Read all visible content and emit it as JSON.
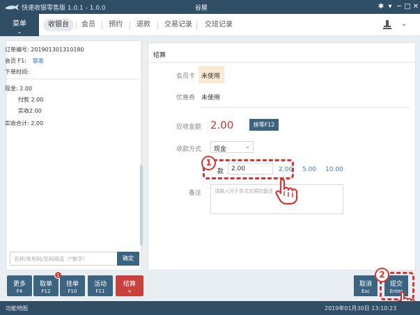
{
  "window": {
    "app_title": "快速收银零售版 1.0.1 - 1.0.0",
    "center_title": "谷屋",
    "controls": [
      "gear-icon",
      "chevron-down-icon",
      "minimize-icon",
      "maximize-icon",
      "close-icon"
    ],
    "controls_glyphs": [
      "✱",
      "▾",
      "─",
      "□",
      "✕"
    ]
  },
  "nav": {
    "menu_label": "菜单",
    "tabs": [
      {
        "label": "收银台",
        "active": true
      },
      {
        "label": "会员"
      },
      {
        "label": "预约"
      },
      {
        "label": "退款"
      },
      {
        "label": "交易记录"
      },
      {
        "label": "交班记录"
      }
    ]
  },
  "order": {
    "number_label": "订单编号: 201901301310180",
    "member_prefix": "会员 F1:",
    "member_link": "散客",
    "time_label": "下单时间:",
    "cash_label": "现金: 2.00",
    "paid_label": "付款 2.00",
    "received_label": "实收2.00",
    "total_label": "实收合计: 2.00"
  },
  "left_bottom": {
    "scan_placeholder": "名称/条形码/无码商品（*数字）",
    "confirm_label": "确定"
  },
  "actions": [
    {
      "label": "更多",
      "key": "F4"
    },
    {
      "label": "取单",
      "key": "F12",
      "badge": "1"
    },
    {
      "label": "挂单",
      "key": "F10"
    },
    {
      "label": "活动",
      "key": "F11"
    },
    {
      "label": "结算",
      "key": "+"
    }
  ],
  "settle": {
    "title": "结算",
    "card_label": "会员卡",
    "card_value": "未使用",
    "coupon_label": "优惠券",
    "coupon_value": "未使用",
    "amount_label": "应收金额",
    "amount_value": "2.00",
    "zero_btn": "抹零F12",
    "method_label": "收款方式",
    "method_value": "现金",
    "pay_label": "款",
    "pay_value": "2.00",
    "quick_amounts": [
      "2.00",
      "5.00",
      "10.00"
    ],
    "remark_label": "备注",
    "remark_placeholder": "请输入对于本次交易的备注"
  },
  "bottom_right": {
    "cancel_label": "取消",
    "cancel_key": "Esc",
    "submit_label": "提交",
    "submit_key": "Enter"
  },
  "steps": [
    "1",
    "2"
  ],
  "status": {
    "left": "功能地图",
    "time": "2019年01月30日 13:10:23"
  },
  "colors": {
    "header_bg": "#2f4e66",
    "button_bg": "#3c6480",
    "accent_red": "#c23a36",
    "annotation_red": "#e03030"
  }
}
